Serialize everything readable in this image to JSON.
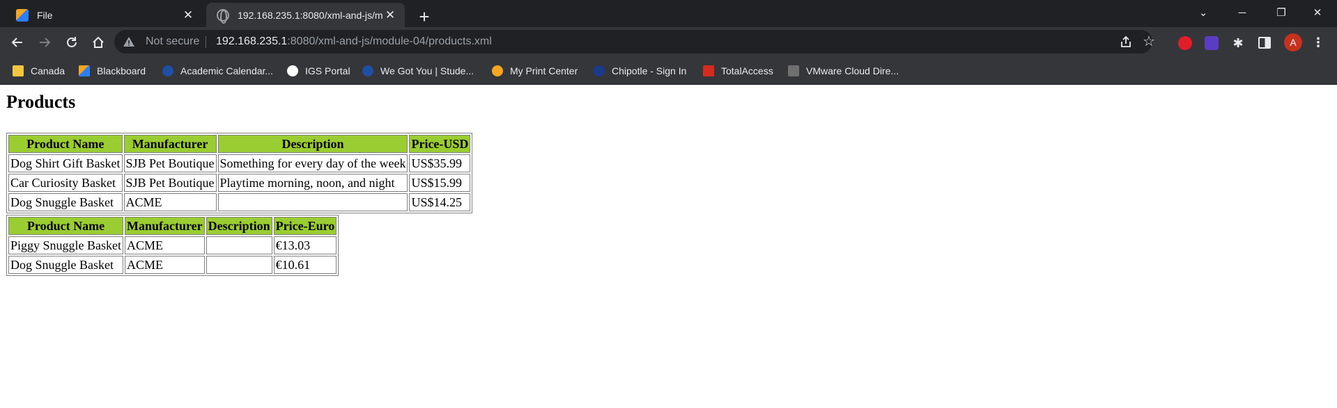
{
  "browser": {
    "tabs": [
      {
        "title": "File",
        "active": false,
        "icon": "file-icon"
      },
      {
        "title": "192.168.235.1:8080/xml-and-js/m",
        "active": true,
        "icon": "globe-icon"
      }
    ],
    "omnibox": {
      "security_label": "Not secure",
      "url_host": "192.168.235.1",
      "url_rest": ":8080/xml-and-js/module-04/products.xml"
    },
    "profile_initial": "A",
    "bookmarks": [
      {
        "label": "Canada",
        "icon": "folder-icon",
        "color": "#f4c542"
      },
      {
        "label": "Blackboard",
        "icon": "blackboard-icon",
        "color": "#f5a623"
      },
      {
        "label": "Academic Calendar...",
        "icon": "school-icon",
        "color": "#1f4fa3"
      },
      {
        "label": "IGS Portal",
        "icon": "igs-icon",
        "color": "#ffffff"
      },
      {
        "label": "We Got You | Stude...",
        "icon": "school-icon",
        "color": "#1f4fa3"
      },
      {
        "label": "My Print Center",
        "icon": "print-icon",
        "color": "#f5a623"
      },
      {
        "label": "Chipotle - Sign In",
        "icon": "chipotle-icon",
        "color": "#1a3b8c"
      },
      {
        "label": "TotalAccess",
        "icon": "totalaccess-icon",
        "color": "#d52b1e"
      },
      {
        "label": "VMware Cloud Dire...",
        "icon": "vmware-icon",
        "color": "#6f6f6f"
      }
    ]
  },
  "page": {
    "title": "Products",
    "usd_table": {
      "headers": [
        "Product Name",
        "Manufacturer",
        "Description",
        "Price-USD"
      ],
      "rows": [
        [
          "Dog Shirt Gift Basket",
          "SJB Pet Boutique",
          "Something for every day of the week",
          "US$35.99"
        ],
        [
          "Car Curiosity Basket",
          "SJB Pet Boutique",
          "Playtime morning, noon, and night",
          "US$15.99"
        ],
        [
          "Dog Snuggle Basket",
          "ACME",
          "",
          "US$14.25"
        ]
      ]
    },
    "euro_table": {
      "headers": [
        "Product Name",
        "Manufacturer",
        "Description",
        "Price-Euro"
      ],
      "rows": [
        [
          "Piggy Snuggle Basket",
          "ACME",
          "",
          "€13.03"
        ],
        [
          "Dog Snuggle Basket",
          "ACME",
          "",
          "€10.61"
        ]
      ]
    },
    "header_color": "#9acd32"
  }
}
